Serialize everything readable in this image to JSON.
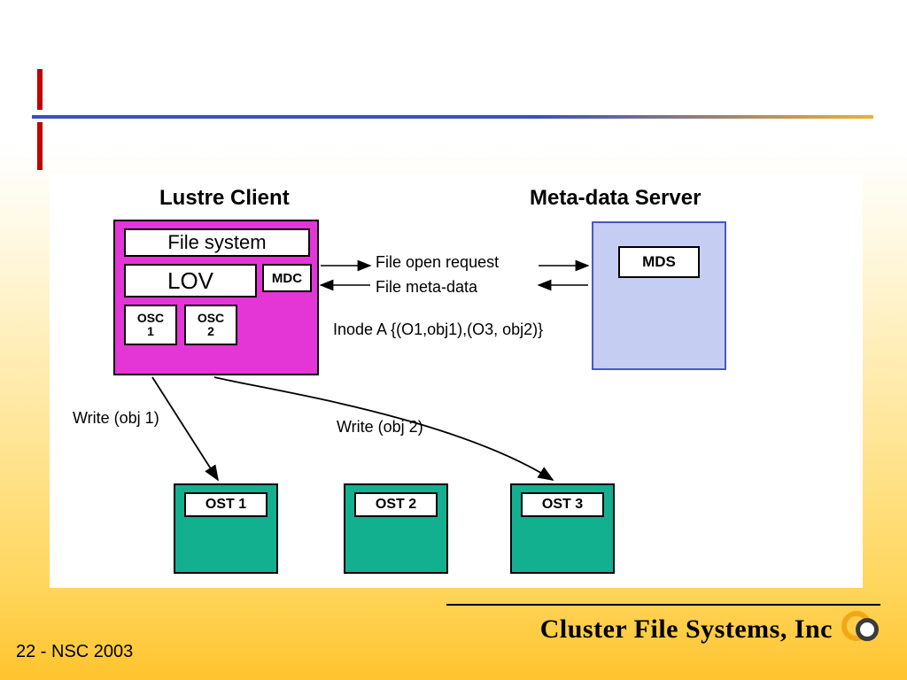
{
  "headings": {
    "client": "Lustre Client",
    "server": "Meta-data Server"
  },
  "client": {
    "filesystem": "File system",
    "lov": "LOV",
    "mdc": "MDC",
    "osc1_line1": "OSC",
    "osc1_line2": "1",
    "osc2_line1": "OSC",
    "osc2_line2": "2"
  },
  "server": {
    "mds": "MDS"
  },
  "messages": {
    "open_request": "File open request",
    "meta_data": "File meta-data",
    "inode": "Inode A {(O1,obj1),(O3, obj2)}",
    "write1": "Write (obj 1)",
    "write2": "Write (obj 2)"
  },
  "ost": {
    "o1": "OST 1",
    "o2": "OST 2",
    "o3": "OST 3"
  },
  "footer": "22 - NSC 2003",
  "brand": "Cluster File Systems, Inc"
}
